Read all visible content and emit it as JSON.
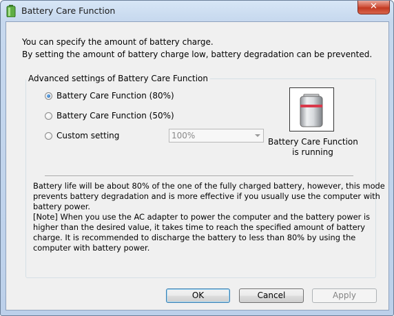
{
  "window": {
    "title": "Battery Care Function",
    "close_glyph": "✕"
  },
  "intro": {
    "line1": "You can specify the amount of battery charge.",
    "line2": "By setting the amount of battery charge low, battery degradation can be prevented."
  },
  "group": {
    "title": "Advanced settings of Battery Care Function",
    "options": [
      {
        "label": "Battery Care Function (80%)",
        "selected": true
      },
      {
        "label": "Battery Care Function (50%)",
        "selected": false
      },
      {
        "label": "Custom setting",
        "selected": false
      }
    ],
    "custom_value": "100%",
    "custom_enabled": false,
    "status_line1": "Battery Care Function",
    "status_line2": "is running",
    "status_icon": "battery-icon",
    "description": [
      "Battery life will be about 80% of the one of the fully charged battery, however, this mode",
      "prevents battery degradation and is more effective if you usually use the computer with",
      "battery power.",
      "[Note] When you use the AC adapter to power the computer and the battery power is",
      "higher than the desired value, it takes time to reach the specified amount of battery",
      "charge. It is recommended to discharge the battery to less than 80% by using the",
      "computer with battery power."
    ]
  },
  "buttons": {
    "ok": "OK",
    "cancel": "Cancel",
    "apply": "Apply"
  },
  "colors": {
    "selected_radio": "#1f5fa8",
    "close_button": "#c23a22",
    "battery_band": "#d9384a"
  }
}
